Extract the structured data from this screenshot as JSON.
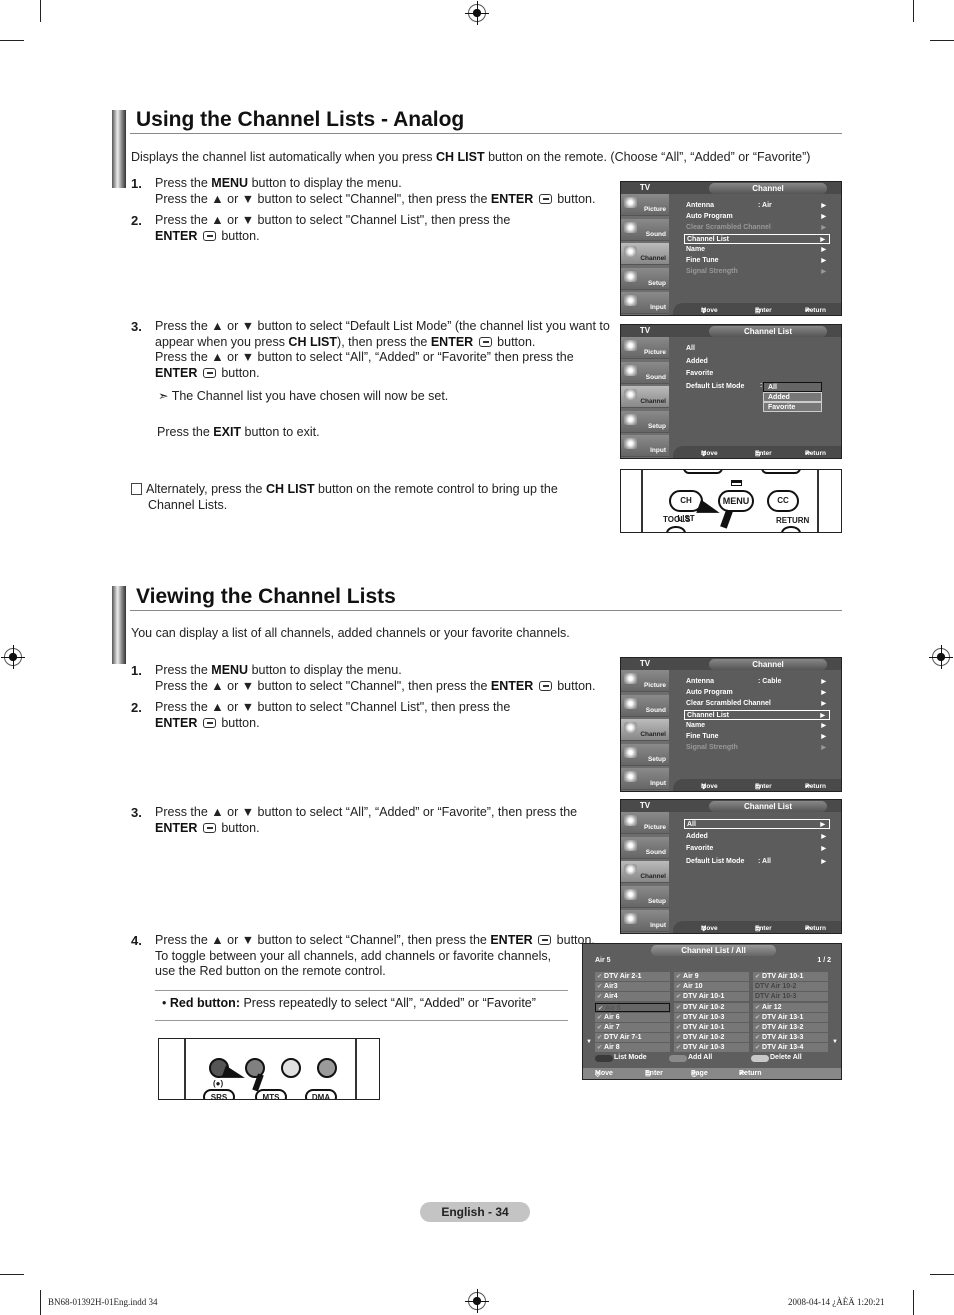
{
  "section1": {
    "title": "Using the Channel Lists - Analog",
    "intro_pre": "Displays the channel list automatically when you press ",
    "intro_bold": "CH LIST",
    "intro_post": " button on the remote. (Choose “All”, “Added” or “Favorite”)",
    "steps": [
      {
        "num": "1.",
        "l1_pre": "Press the ",
        "l1_bold": "MENU",
        "l1_post": " button to display the menu.",
        "l2_pre": "Press the ▲ or ▼ button to select \"Channel\", then press the ",
        "l2_bold": "ENTER",
        "l2_post": " button."
      },
      {
        "num": "2.",
        "l1": "Press the ▲ or ▼ button to select \"Channel List\", then press the",
        "l2_bold": "ENTER",
        "l2_post": " button."
      },
      {
        "num": "3.",
        "l1": "Press the ▲ or ▼ button to select “Default List Mode” (the channel list you want to",
        "l2_pre": "appear when you press ",
        "l2_bold": "CH LIST",
        "l2_mid": "), then press the ",
        "l2_bold2": "ENTER",
        "l2_post": " button.",
        "l3": "Press the ▲ or ▼ button to select “All”, “Added” or “Favorite” then press the",
        "l4_bold": "ENTER",
        "l4_post": " button.",
        "note": "➣ The Channel list you have chosen will now be set.",
        "exit_pre": "Press the ",
        "exit_bold": "EXIT",
        "exit_post": " button to exit."
      }
    ],
    "alt_pre": "Alternately, press the ",
    "alt_bold": "CH LIST",
    "alt_post": " button on the remote control to bring up the",
    "alt_l2": "Channel Lists."
  },
  "section2": {
    "title": "Viewing the Channel Lists",
    "intro": "You can display a list of all channels, added channels or your favorite channels.",
    "steps": [
      {
        "num": "1.",
        "l1_pre": "Press the ",
        "l1_bold": "MENU",
        "l1_post": " button to display the menu.",
        "l2_pre": "Press the ▲ or ▼ button to select \"Channel\", then press the ",
        "l2_bold": "ENTER",
        "l2_post": " button."
      },
      {
        "num": "2.",
        "l1": "Press the ▲ or ▼ button to select \"Channel List\", then press the",
        "l2_bold": "ENTER",
        "l2_post": " button."
      },
      {
        "num": "3.",
        "l1": "Press the ▲ or ▼ button to select “All”, “Added” or “Favorite”, then press the",
        "l2_bold": "ENTER",
        "l2_post": " button."
      },
      {
        "num": "4.",
        "l1_pre": "Press the ▲ or ▼ button to select “Channel”, then press the ",
        "l1_bold": "ENTER",
        "l1_post": " button.",
        "l2": "To toggle between your all channels, add channels or favorite channels,",
        "l3": "use the Red button on the remote control."
      }
    ],
    "red_bold": "Red button:",
    "red_text": " Press repeatedly to select “All”, “Added” or “Favorite”"
  },
  "osd": {
    "tv_label": "TV",
    "side": [
      "Picture",
      "Sound",
      "Channel",
      "Setup",
      "Input"
    ],
    "footer": {
      "move": "Move",
      "enter": "Enter",
      "return": "Return"
    },
    "channel_menu_analog": {
      "title": "Channel",
      "items": [
        {
          "label": "Antenna",
          "value": ": Air",
          "dim": false
        },
        {
          "label": "Auto Program",
          "value": "",
          "dim": false
        },
        {
          "label": "Clear Scrambled Channel",
          "value": "",
          "dim": true
        },
        {
          "label": "Channel List",
          "value": "",
          "dim": false
        },
        {
          "label": "Name",
          "value": "",
          "dim": false
        },
        {
          "label": "Fine Tune",
          "value": "",
          "dim": false
        },
        {
          "label": "Signal Strength",
          "value": "",
          "dim": true
        }
      ],
      "selected": "Channel List"
    },
    "channel_list_dropdown": {
      "title": "Channel List",
      "items": [
        "All",
        "Added",
        "Favorite",
        "Default List Mode"
      ],
      "dropdown": [
        "All",
        "Added",
        "Favorite"
      ],
      "selected": "All"
    },
    "channel_menu_cable": {
      "title": "Channel",
      "items": [
        {
          "label": "Antenna",
          "value": ": Cable",
          "dim": false
        },
        {
          "label": "Auto Program",
          "value": "",
          "dim": false
        },
        {
          "label": "Clear Scrambled Channel",
          "value": "",
          "dim": false
        },
        {
          "label": "Channel List",
          "value": "",
          "dim": false
        },
        {
          "label": "Name",
          "value": "",
          "dim": false
        },
        {
          "label": "Fine Tune",
          "value": "",
          "dim": false
        },
        {
          "label": "Signal Strength",
          "value": "",
          "dim": true
        }
      ],
      "selected": "Channel List"
    },
    "channel_list_menu": {
      "title": "Channel List",
      "items": [
        {
          "label": "All",
          "value": ""
        },
        {
          "label": "Added",
          "value": ""
        },
        {
          "label": "Favorite",
          "value": ""
        },
        {
          "label": "Default List Mode",
          "value": ": All"
        }
      ],
      "selected": "All"
    }
  },
  "remote1": {
    "buttons": [
      "CH LIST",
      "MENU",
      "CC"
    ],
    "labels": [
      "TOOLS",
      "RETURN"
    ]
  },
  "remote2": {
    "labels": [
      "SRS",
      "MTS",
      "DMA"
    ],
    "button_colors": [
      "#555555",
      "#808080",
      "#e0e0e0",
      "#9a9a9a"
    ]
  },
  "channel_list": {
    "title": "Channel List / All",
    "current": "Air 5",
    "page": "1 / 2",
    "columns": [
      [
        {
          "t": "DTV Air 2-1"
        },
        {
          "t": "Air3"
        },
        {
          "t": "Air4"
        },
        {
          "t": "Air 5",
          "sel": true
        },
        {
          "t": "Air 6"
        },
        {
          "t": "Air 7"
        },
        {
          "t": "DTV Air 7-1"
        },
        {
          "t": "Air 8"
        }
      ],
      [
        {
          "t": "Air 9"
        },
        {
          "t": "Air 10"
        },
        {
          "t": "DTV Air 10-1"
        },
        {
          "t": "DTV Air 10-2"
        },
        {
          "t": "DTV Air 10-3"
        },
        {
          "t": "DTV Air 10-1"
        },
        {
          "t": "DTV Air 10-2"
        },
        {
          "t": "DTV Air 10-3"
        }
      ],
      [
        {
          "t": "DTV Air 10-1"
        },
        {
          "t": "DTV Air 10-2",
          "dim": true
        },
        {
          "t": "DTV Air 10-3",
          "dim": true
        },
        {
          "t": "Air 12"
        },
        {
          "t": "DTV Air 13-1"
        },
        {
          "t": "DTV Air 13-2"
        },
        {
          "t": "DTV Air 13-3"
        },
        {
          "t": "DTV Air 13-4"
        }
      ]
    ],
    "legend": [
      {
        "label": "List Mode",
        "color": "#3a3a3a"
      },
      {
        "label": "Add All",
        "color": "#8a8a8a"
      },
      {
        "label": "Delete All",
        "color": "#c8c8c8"
      }
    ],
    "footer": {
      "move": "Move",
      "enter": "Enter",
      "page": "Page",
      "return": "Return"
    }
  },
  "page_label": "English - 34",
  "slug_left": "BN68-01392H-01Eng.indd   34",
  "slug_right": "2008-04-14   ¿ÀÈÄ 1:20:21"
}
